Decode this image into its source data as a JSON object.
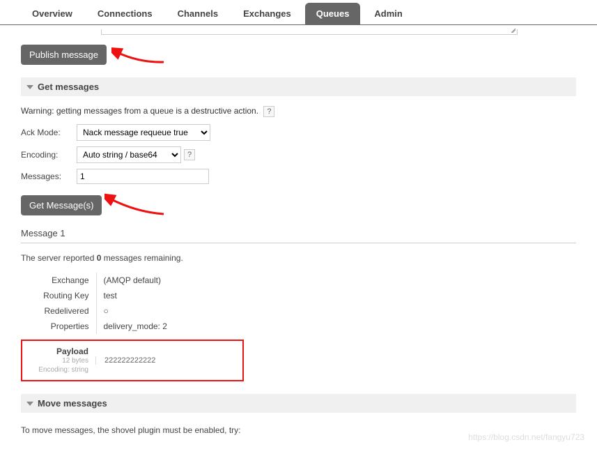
{
  "tabs": {
    "overview": "Overview",
    "connections": "Connections",
    "channels": "Channels",
    "exchanges": "Exchanges",
    "queues": "Queues",
    "admin": "Admin"
  },
  "publish_button": "Publish message",
  "sections": {
    "get_messages": "Get messages",
    "move_messages": "Move messages"
  },
  "warning_text": "Warning: getting messages from a queue is a destructive action.",
  "help_char": "?",
  "form": {
    "ack_mode_label": "Ack Mode:",
    "ack_mode_value": "Nack message requeue true",
    "encoding_label": "Encoding:",
    "encoding_value": "Auto string / base64",
    "messages_label": "Messages:",
    "messages_value": "1"
  },
  "get_button": "Get Message(s)",
  "message_header": "Message 1",
  "remaining_prefix": "The server reported ",
  "remaining_count": "0",
  "remaining_suffix": " messages remaining.",
  "msg": {
    "exchange_label": "Exchange",
    "exchange_value": "(AMQP default)",
    "routing_key_label": "Routing Key",
    "routing_key_value": "test",
    "redelivered_label": "Redelivered",
    "redelivered_value": "○",
    "properties_label": "Properties",
    "properties_key": "delivery_mode:",
    "properties_val": "2"
  },
  "payload": {
    "title": "Payload",
    "bytes": "12 bytes",
    "encoding": "Encoding: string",
    "content": "222222222222"
  },
  "cutoff_text": "To move messages, the shovel plugin must be enabled, try:",
  "watermark": "https://blog.csdn.net/fangyu723"
}
